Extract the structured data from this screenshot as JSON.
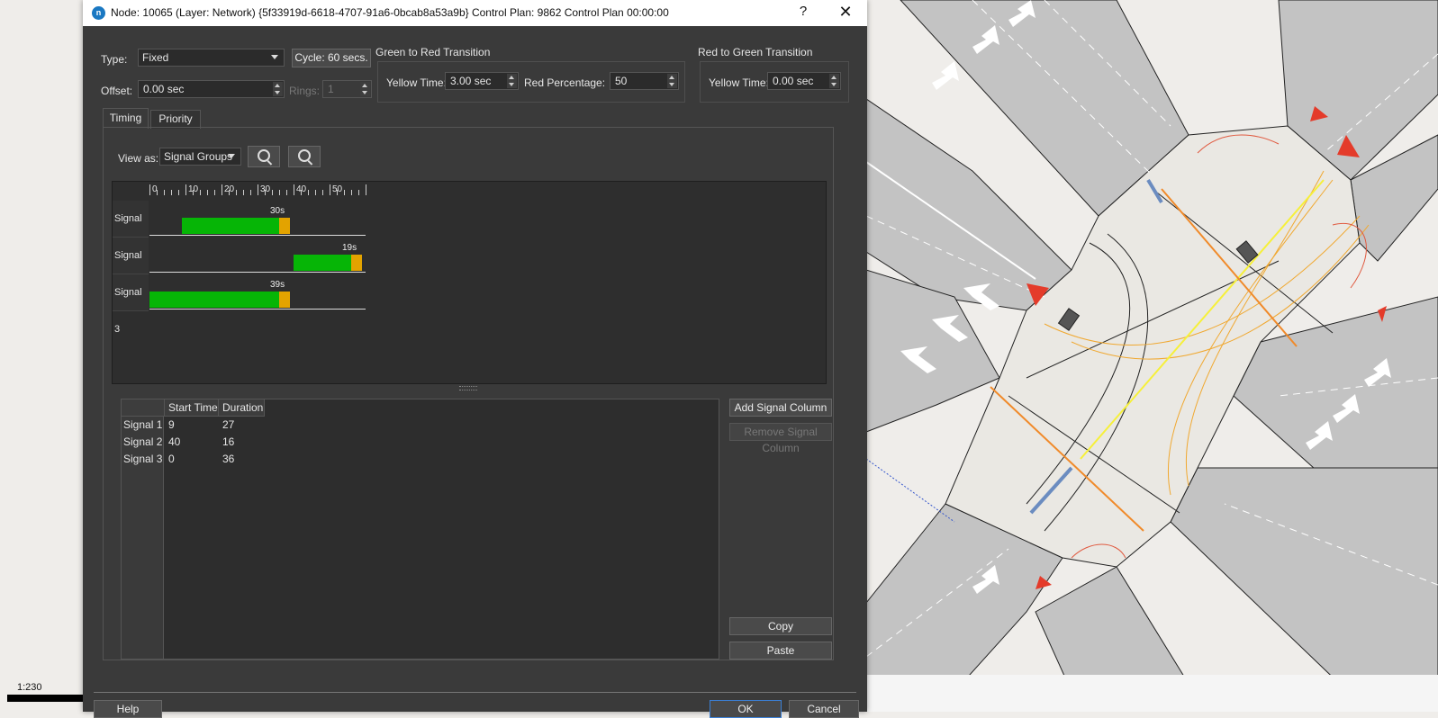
{
  "dialog": {
    "title": "Node: 10065 (Layer: Network) {5f33919d-6618-4707-91a6-0bcab8a53a9b} Control Plan: 9862 Control Plan 00:00:00",
    "logo_text": "n",
    "help_glyph": "?",
    "close_glyph": "✕"
  },
  "settings": {
    "type_label": "Type:",
    "type_value": "Fixed",
    "cycle_button": "Cycle: 60 secs.",
    "offset_label": "Offset:",
    "offset_value": "0.00 sec",
    "rings_label": "Rings:",
    "rings_value": "1"
  },
  "green_to_red": {
    "title": "Green to Red Transition",
    "yellow_label": "Yellow Time:",
    "yellow_value": "3.00 sec",
    "red_pct_label": "Red Percentage:",
    "red_pct_value": "50"
  },
  "red_to_green": {
    "title": "Red to Green Transition",
    "yellow_label": "Yellow Time:",
    "yellow_value": "0.00 sec"
  },
  "tabs": [
    {
      "label": "Timing"
    },
    {
      "label": "Priority"
    }
  ],
  "view": {
    "label": "View as:",
    "value": "Signal Groups"
  },
  "timeline": {
    "ticks": [
      "0",
      "10",
      "20",
      "30",
      "40",
      "50"
    ],
    "cycle": 60,
    "signals": [
      {
        "name": "Signal 1",
        "green_start": 9,
        "green_duration": 27,
        "yellow_duration": 3,
        "label": "30s"
      },
      {
        "name": "Signal 2",
        "green_start": 40,
        "green_duration": 16,
        "yellow_duration": 3,
        "label": "19s"
      },
      {
        "name": "Signal 3",
        "green_start": 0,
        "green_duration": 36,
        "yellow_duration": 3,
        "label": "39s"
      }
    ]
  },
  "table": {
    "headers": [
      "Start Time",
      "Duration"
    ],
    "rows": [
      {
        "name": "Signal 1",
        "start": "9",
        "duration": "27"
      },
      {
        "name": "Signal 2",
        "start": "40",
        "duration": "16"
      },
      {
        "name": "Signal 3",
        "start": "0",
        "duration": "36"
      }
    ]
  },
  "side_buttons": {
    "add": "Add Signal Column",
    "remove": "Remove Signal Column",
    "copy": "Copy",
    "paste": "Paste"
  },
  "footer": {
    "help": "Help",
    "ok": "OK",
    "cancel": "Cancel"
  },
  "map": {
    "scale_text": "1:230"
  }
}
